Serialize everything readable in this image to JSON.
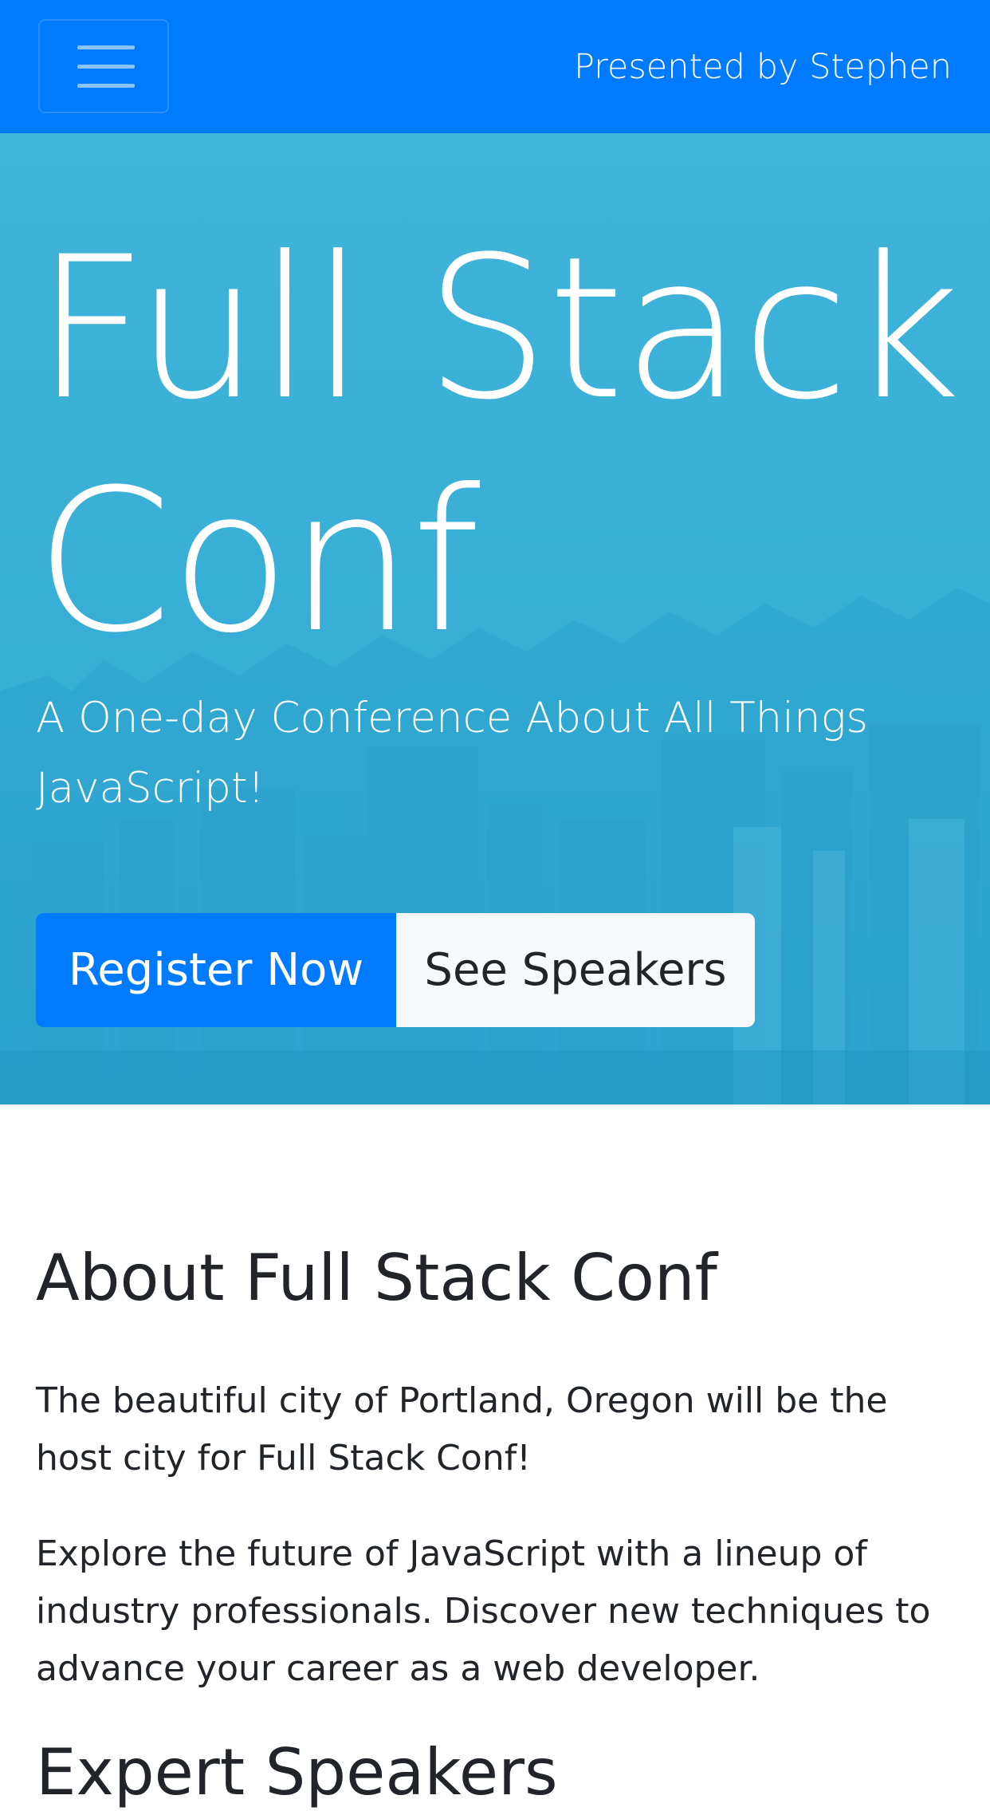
{
  "navbar": {
    "toggler_label": "Toggle navigation",
    "brand": "Presented by Stephen"
  },
  "hero": {
    "title": "Full Stack Conf",
    "lead": "A One-day Conference About All Things JavaScript!",
    "register_button": "Register Now",
    "speakers_button": "See Speakers"
  },
  "about": {
    "title": "About Full Stack Conf",
    "paragraphs": [
      "The beautiful city of Portland, Oregon will be the host city for Full Stack Conf!",
      "Explore the future of JavaScript with a lineup of industry professionals. Discover new techniques to advance your career as a web developer."
    ]
  },
  "next_section": {
    "title": "Expert Speakers"
  },
  "colors": {
    "primary": "#007bff",
    "hero_background": "#3ab0d7",
    "light_button": "#f8f9fa",
    "text": "#212529"
  },
  "icons": {
    "menu": "hamburger-menu-icon"
  }
}
